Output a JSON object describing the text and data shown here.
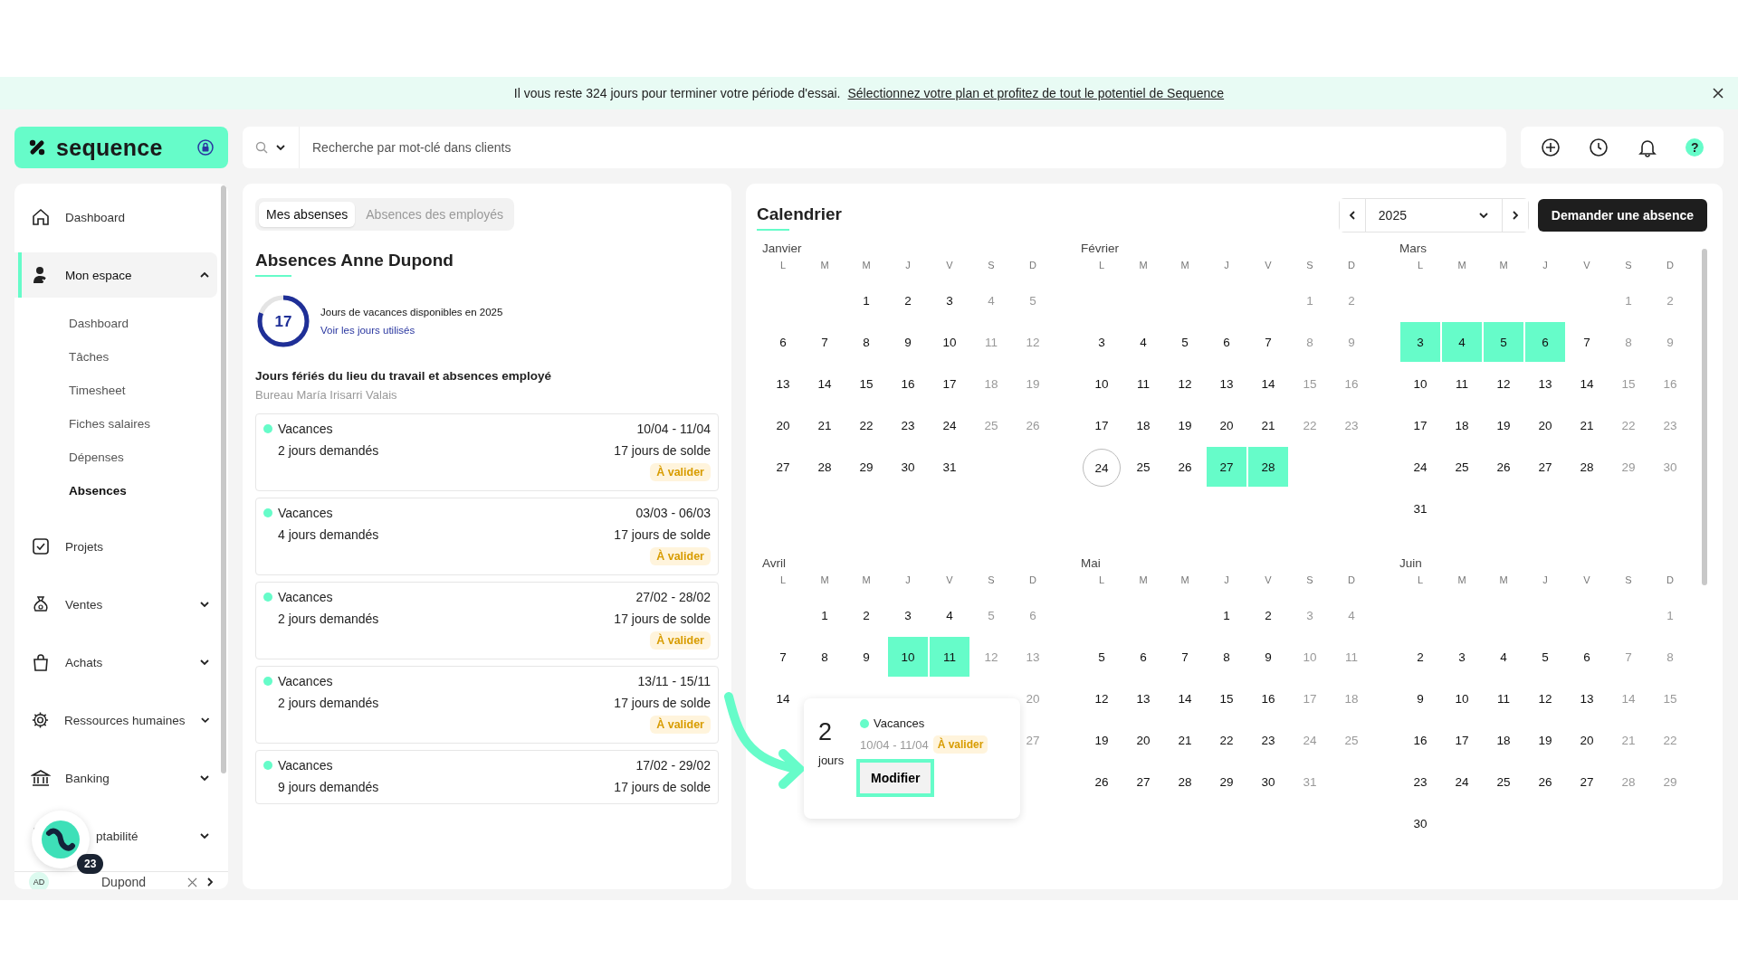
{
  "banner": {
    "message": "Il vous reste 324 jours pour terminer votre période d'essai.",
    "link": "Sélectionnez votre plan et profitez de tout le potentiel de Sequence"
  },
  "header": {
    "logo": "sequence",
    "search_placeholder": "Recherche par mot-clé dans clients",
    "help_label": "?"
  },
  "sidebar": {
    "items": [
      {
        "kind": "link",
        "label": "Dashboard"
      },
      {
        "kind": "group",
        "label": "Mon espace",
        "expanded": true,
        "selected": true,
        "children": [
          {
            "label": "Dashboard",
            "selected": false
          },
          {
            "label": "Tâches",
            "selected": false
          },
          {
            "label": "Timesheet",
            "selected": false
          },
          {
            "label": "Fiches salaires",
            "selected": false
          },
          {
            "label": "Dépenses",
            "selected": false
          },
          {
            "label": "Absences",
            "selected": true
          }
        ]
      },
      {
        "kind": "link",
        "label": "Projets"
      },
      {
        "kind": "group",
        "label": "Ventes",
        "expanded": false,
        "selected": false
      },
      {
        "kind": "group",
        "label": "Achats",
        "expanded": false,
        "selected": false
      },
      {
        "kind": "group",
        "label": "Ressources humaines",
        "expanded": false,
        "selected": false
      },
      {
        "kind": "group",
        "label": "Banking",
        "expanded": false,
        "selected": false
      },
      {
        "kind": "group",
        "label": "ptabilité",
        "expanded": false,
        "selected": false
      }
    ],
    "user": {
      "initials": "AD",
      "name": "Dupond"
    },
    "launcher_badge": "23"
  },
  "absences": {
    "tabs": [
      {
        "label": "Mes absenses",
        "selected": true
      },
      {
        "label": "Absences des employés",
        "selected": false
      }
    ],
    "title": "Absences Anne Dupond",
    "balance": {
      "value": "17",
      "level": 0.8,
      "caption": "Jours de vacances disponibles en 2025",
      "link": "Voir les jours utilisés"
    },
    "section_title": "Jours fériés du lieu du travail et absences employé",
    "section_subtitle": "Bureau María Irisarri Valais",
    "requests": [
      {
        "type": "Vacances",
        "color": "#66fcc9",
        "dates": "10/04 - 11/04",
        "requested": "2 jours demandés",
        "balance": "17 jours de solde",
        "status": "À valider"
      },
      {
        "type": "Vacances",
        "color": "#66fcc9",
        "dates": "03/03 - 06/03",
        "requested": "4 jours demandés",
        "balance": "17 jours de solde",
        "status": "À valider"
      },
      {
        "type": "Vacances",
        "color": "#66fcc9",
        "dates": "27/02 - 28/02",
        "requested": "2 jours demandés",
        "balance": "17 jours de solde",
        "status": "À valider"
      },
      {
        "type": "Vacances",
        "color": "#66fcc9",
        "dates": "13/11 - 15/11",
        "requested": "2 jours demandés",
        "balance": "17 jours de solde",
        "status": "À valider"
      },
      {
        "type": "Vacances",
        "color": "#66fcc9",
        "dates": "17/02 - 29/02",
        "requested": "9 jours demandés",
        "balance": "17 jours de solde"
      }
    ]
  },
  "calendar": {
    "title": "Calendrier",
    "year": "2025",
    "request_button": "Demander une absence",
    "months": [
      {
        "name": "Janvier",
        "weekdays": [
          "L",
          "M",
          "M",
          "J",
          "V",
          "S",
          "D"
        ],
        "weeks": [
          [
            "1",
            "2",
            "3",
            "4",
            "5"
          ],
          [
            "6",
            "7",
            "8",
            "9",
            "10",
            "11",
            "12"
          ],
          [
            "13",
            "14",
            "15",
            "16",
            "17",
            "18",
            "19"
          ],
          [
            "20",
            "21",
            "22",
            "23",
            "24",
            "25",
            "26"
          ],
          [
            "27",
            "28",
            "29",
            "30",
            "31"
          ]
        ]
      },
      {
        "name": "Février",
        "weekdays": [
          "L",
          "M",
          "M",
          "J",
          "V",
          "S",
          "D"
        ],
        "weeks": [
          [
            "1",
            "2"
          ],
          [
            "3",
            "4",
            "5",
            "6",
            "7",
            "8",
            "9"
          ],
          [
            "10",
            "11",
            "12",
            "13",
            "14",
            "15",
            "16"
          ],
          [
            "17",
            "18",
            "19",
            "20",
            "21",
            "22",
            "23"
          ],
          [
            {
              "day": "24",
              "today": true
            },
            "25",
            "26",
            {
              "day": "27",
              "absence": true
            },
            {
              "day": "28",
              "absence": true
            }
          ]
        ]
      },
      {
        "name": "Mars",
        "weekdays": [
          "L",
          "M",
          "M",
          "J",
          "V",
          "S",
          "D"
        ],
        "weeks": [
          [
            "1",
            "2"
          ],
          [
            {
              "day": "3",
              "absence": true
            },
            {
              "day": "4",
              "absence": true
            },
            {
              "day": "5",
              "absence": true
            },
            {
              "day": "6",
              "absence": true
            },
            "7",
            "8",
            "9"
          ],
          [
            "10",
            "11",
            "12",
            "13",
            "14",
            "15",
            "16"
          ],
          [
            "17",
            "18",
            "19",
            "20",
            "21",
            "22",
            "23"
          ],
          [
            "24",
            "25",
            "26",
            "27",
            "28",
            "29",
            "30"
          ],
          [
            "31"
          ]
        ]
      },
      {
        "name": "Avril",
        "weekdays": [
          "L",
          "M",
          "M",
          "J",
          "V",
          "S",
          "D"
        ],
        "weeks": [
          [
            "1",
            "2",
            "3",
            "4",
            "5",
            "6"
          ],
          [
            "7",
            "8",
            "9",
            {
              "day": "10",
              "absence": true
            },
            {
              "day": "11",
              "absence": true
            },
            "12",
            "13"
          ],
          {
            "first": "14",
            "last": "20"
          },
          {
            "last": "27"
          }
        ]
      },
      {
        "name": "Mai",
        "weekdays": [
          "L",
          "M",
          "M",
          "J",
          "V",
          "S",
          "D"
        ],
        "weeks": [
          [
            "1",
            "2",
            "3",
            "4"
          ],
          [
            "5",
            "6",
            "7",
            "8",
            "9",
            "10",
            "11"
          ],
          [
            "12",
            "13",
            "14",
            "15",
            "16",
            "17",
            "18"
          ],
          [
            "19",
            "20",
            "21",
            "22",
            "23",
            "24",
            "25"
          ],
          [
            "26",
            "27",
            "28",
            "29",
            "30",
            "31"
          ]
        ]
      },
      {
        "name": "Juin",
        "weekdays": [
          "L",
          "M",
          "M",
          "J",
          "V",
          "S",
          "D"
        ],
        "weeks": [
          [
            "1"
          ],
          [
            "2",
            "3",
            "4",
            "5",
            "6",
            "7",
            "8"
          ],
          [
            "9",
            "10",
            "11",
            "12",
            "13",
            "14",
            "15"
          ],
          [
            "16",
            "17",
            "18",
            "19",
            "20",
            "21",
            "22"
          ],
          [
            "23",
            "24",
            "25",
            "26",
            "27",
            "28",
            "29"
          ],
          [
            "30"
          ]
        ]
      }
    ],
    "popover": {
      "count": "2",
      "unit": "jours",
      "type": "Vacances",
      "color": "#66fcc9",
      "dates": "10/04 - 11/04",
      "status": "À valider",
      "button": "Modifier"
    }
  }
}
